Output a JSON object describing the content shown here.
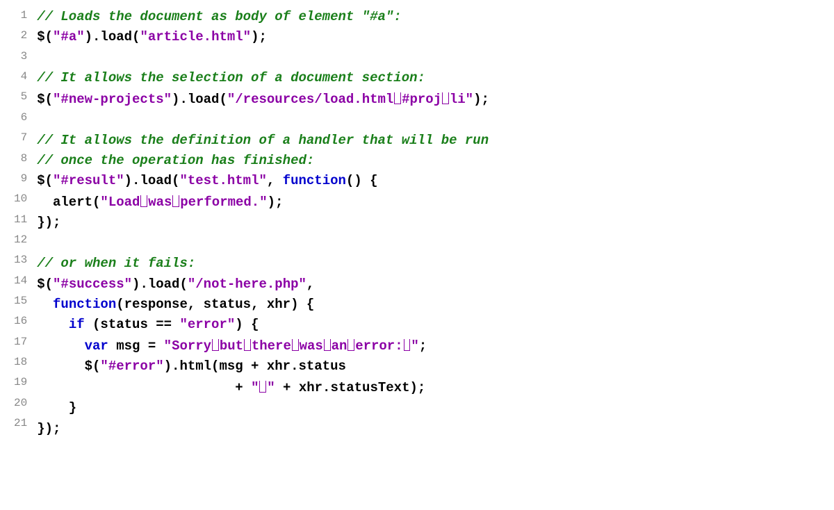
{
  "lines": [
    {
      "n": "1",
      "tokens": [
        {
          "t": "// Loads the document as body of element \"#a\":",
          "c": "comment"
        }
      ]
    },
    {
      "n": "2",
      "tokens": [
        {
          "t": "$(",
          "c": "punct"
        },
        {
          "t": "\"#a\"",
          "c": "string"
        },
        {
          "t": ").load(",
          "c": "punct"
        },
        {
          "t": "\"article.html\"",
          "c": "string"
        },
        {
          "t": ");",
          "c": "punct"
        }
      ]
    },
    {
      "n": "3",
      "tokens": []
    },
    {
      "n": "4",
      "tokens": [
        {
          "t": "// It allows the selection of a document section:",
          "c": "comment"
        }
      ]
    },
    {
      "n": "5",
      "tokens": [
        {
          "t": "$(",
          "c": "punct"
        },
        {
          "t": "\"#new-projects\"",
          "c": "string"
        },
        {
          "t": ").load(",
          "c": "punct"
        },
        {
          "t": "\"/resources/load.html",
          "c": "string"
        },
        {
          "t": "",
          "c": "vs"
        },
        {
          "t": "#proj",
          "c": "string"
        },
        {
          "t": "",
          "c": "vs"
        },
        {
          "t": "li\"",
          "c": "string"
        },
        {
          "t": ");",
          "c": "punct"
        }
      ]
    },
    {
      "n": "6",
      "tokens": []
    },
    {
      "n": "7",
      "tokens": [
        {
          "t": "// It allows the definition of a handler that will be run",
          "c": "comment"
        }
      ]
    },
    {
      "n": "8",
      "tokens": [
        {
          "t": "// once the operation has finished:",
          "c": "comment"
        }
      ]
    },
    {
      "n": "9",
      "tokens": [
        {
          "t": "$(",
          "c": "punct"
        },
        {
          "t": "\"#result\"",
          "c": "string"
        },
        {
          "t": ").load(",
          "c": "punct"
        },
        {
          "t": "\"test.html\"",
          "c": "string"
        },
        {
          "t": ", ",
          "c": "punct"
        },
        {
          "t": "function",
          "c": "keyword"
        },
        {
          "t": "() {",
          "c": "punct"
        }
      ]
    },
    {
      "n": "10",
      "tokens": [
        {
          "t": "  alert(",
          "c": "punct"
        },
        {
          "t": "\"Load",
          "c": "string"
        },
        {
          "t": "",
          "c": "vs"
        },
        {
          "t": "was",
          "c": "string"
        },
        {
          "t": "",
          "c": "vs"
        },
        {
          "t": "performed.\"",
          "c": "string"
        },
        {
          "t": ");",
          "c": "punct"
        }
      ]
    },
    {
      "n": "11",
      "tokens": [
        {
          "t": "});",
          "c": "punct"
        }
      ]
    },
    {
      "n": "12",
      "tokens": []
    },
    {
      "n": "13",
      "tokens": [
        {
          "t": "// or when it fails:",
          "c": "comment"
        }
      ]
    },
    {
      "n": "14",
      "tokens": [
        {
          "t": "$(",
          "c": "punct"
        },
        {
          "t": "\"#success\"",
          "c": "string"
        },
        {
          "t": ").load(",
          "c": "punct"
        },
        {
          "t": "\"/not-here.php\"",
          "c": "string"
        },
        {
          "t": ",",
          "c": "punct"
        }
      ]
    },
    {
      "n": "15",
      "tokens": [
        {
          "t": "  ",
          "c": "punct"
        },
        {
          "t": "function",
          "c": "keyword"
        },
        {
          "t": "(response, status, xhr) {",
          "c": "punct"
        }
      ]
    },
    {
      "n": "16",
      "tokens": [
        {
          "t": "    ",
          "c": "punct"
        },
        {
          "t": "if",
          "c": "keyword"
        },
        {
          "t": " (status == ",
          "c": "punct"
        },
        {
          "t": "\"error\"",
          "c": "string"
        },
        {
          "t": ") {",
          "c": "punct"
        }
      ]
    },
    {
      "n": "17",
      "tokens": [
        {
          "t": "      ",
          "c": "punct"
        },
        {
          "t": "var",
          "c": "keyword"
        },
        {
          "t": " msg = ",
          "c": "punct"
        },
        {
          "t": "\"Sorry",
          "c": "string"
        },
        {
          "t": "",
          "c": "vs"
        },
        {
          "t": "but",
          "c": "string"
        },
        {
          "t": "",
          "c": "vs"
        },
        {
          "t": "there",
          "c": "string"
        },
        {
          "t": "",
          "c": "vs"
        },
        {
          "t": "was",
          "c": "string"
        },
        {
          "t": "",
          "c": "vs"
        },
        {
          "t": "an",
          "c": "string"
        },
        {
          "t": "",
          "c": "vs"
        },
        {
          "t": "error:",
          "c": "string"
        },
        {
          "t": "",
          "c": "vs"
        },
        {
          "t": "\"",
          "c": "string"
        },
        {
          "t": ";",
          "c": "punct"
        }
      ]
    },
    {
      "n": "18",
      "tokens": [
        {
          "t": "      $(",
          "c": "punct"
        },
        {
          "t": "\"#error\"",
          "c": "string"
        },
        {
          "t": ").html(msg + xhr.status",
          "c": "punct"
        }
      ]
    },
    {
      "n": "19",
      "tokens": [
        {
          "t": "                         + ",
          "c": "punct"
        },
        {
          "t": "\"",
          "c": "string"
        },
        {
          "t": "",
          "c": "vs"
        },
        {
          "t": "\"",
          "c": "string"
        },
        {
          "t": " + xhr.statusText);",
          "c": "punct"
        }
      ]
    },
    {
      "n": "20",
      "tokens": [
        {
          "t": "    }",
          "c": "punct"
        }
      ]
    },
    {
      "n": "21",
      "tokens": [
        {
          "t": "});",
          "c": "punct"
        }
      ]
    }
  ]
}
